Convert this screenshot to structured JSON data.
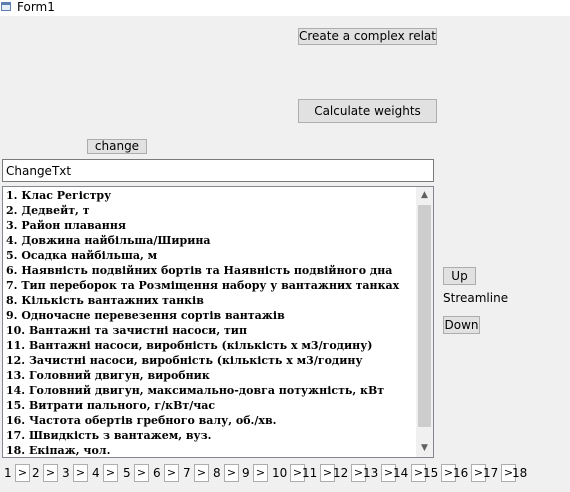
{
  "window": {
    "title": "Form1"
  },
  "buttons": {
    "create_relation": "Create a complex relation",
    "calculate_weights": "Calculate weights",
    "change": "change",
    "up": "Up",
    "down": "Down"
  },
  "text_input": {
    "value": "ChangeTxt"
  },
  "streamline_label": "Streamline",
  "list_items": [
    "1. Клас Регістру",
    "2. Дедвейт, т",
    "3. Район плавання",
    "4. Довжина найбільша/Ширина",
    "5. Осадка найбільша, м",
    "6. Наявність подвійних бортів та Наявність подвійного дна",
    "7. Тип  переборок та Розміщення набору у вантажних танках",
    "8. Кількість вантажних танків",
    "9. Одночасне перевезення сортів вантажів",
    "10. Вантажні та зачистні насоси, тип",
    "11. Вантажні насоси, вироб­ність (кількість х м3/годину)",
    "12. Зачистні насоси, вироб­ність (кількість х м3/годину",
    "13. Головний двигун, виробник",
    "14. Головний двигун, максимально-довга потужність, кВт",
    "15. Витрати пального, г/кВт/час",
    "16. Частота обертів гребного валу, об./хв.",
    "17. Швидкість з вантажем, вуз.",
    "18. Екіпаж, чол."
  ],
  "scroll_icons": {
    "up": "chevron-up-icon",
    "down": "chevron-down-icon"
  },
  "pager": {
    "numbers": [
      "1",
      "2",
      "3",
      "4",
      "5",
      "6",
      "7",
      "8",
      "9",
      "10",
      "11",
      "12",
      "13",
      "14",
      "15",
      "16",
      "17",
      "18"
    ],
    "next_label": ">"
  }
}
